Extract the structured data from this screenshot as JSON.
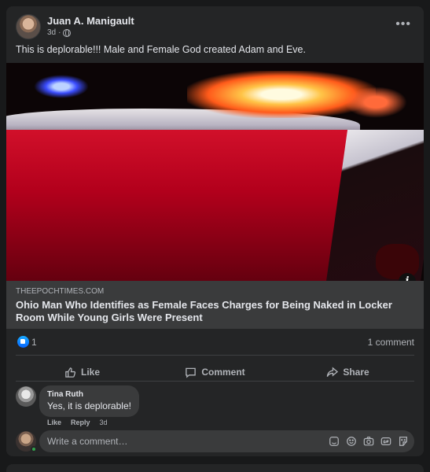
{
  "post": {
    "author": "Juan A. Manigault",
    "time": "3d",
    "separator": "·",
    "more": "•••",
    "text": "This is deplorable!!!  Male and Female God created Adam and Eve."
  },
  "link": {
    "source": "THEEPOCHTIMES.COM",
    "headline": "Ohio Man Who Identifies as Female Faces Charges for Being Naked in Locker Room While Young Girls Were Present",
    "info": "i"
  },
  "reactions": {
    "like_count": "1",
    "comment_count": "1 comment"
  },
  "actions": {
    "like": "Like",
    "comment": "Comment",
    "share": "Share"
  },
  "comment": {
    "author": "Tina Ruth",
    "text": "Yes, it is deplorable!",
    "like": "Like",
    "reply": "Reply",
    "time": "3d"
  },
  "composer": {
    "placeholder": "Write a comment…"
  },
  "colors": {
    "background": "#18191a",
    "card": "#242526",
    "bubble": "#3a3b3c",
    "like_blue": "#0866ff",
    "secondary_text": "#b0b3b8"
  }
}
